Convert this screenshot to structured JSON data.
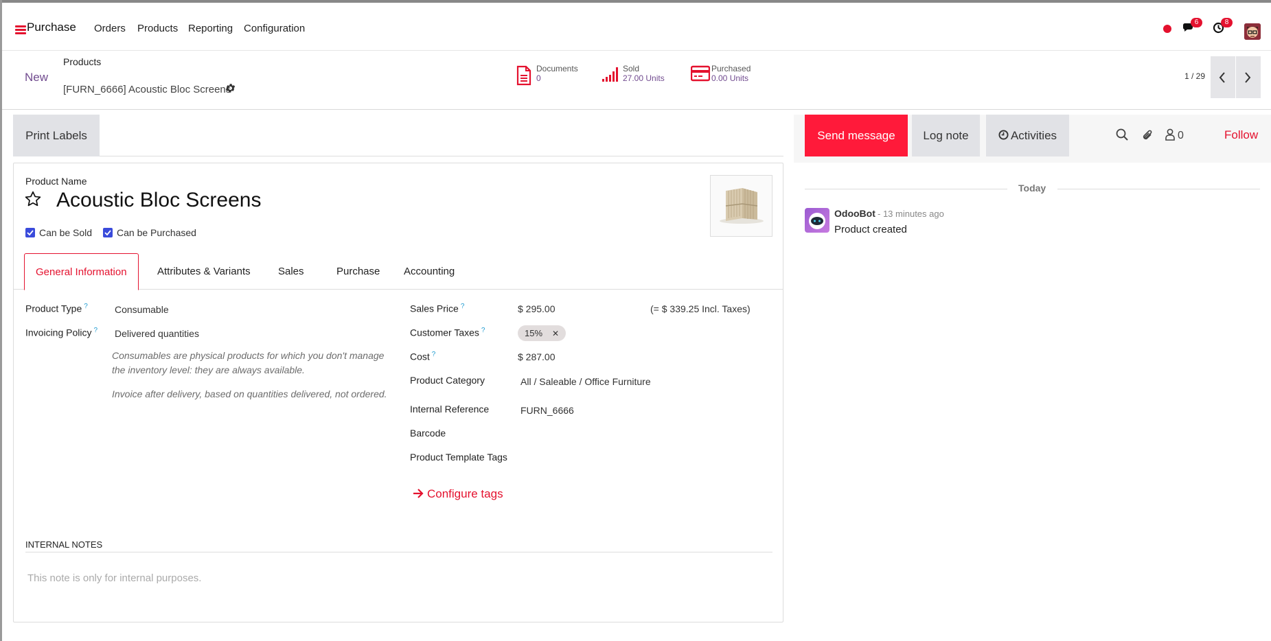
{
  "navbar": {
    "app_name": "Purchase",
    "menu": [
      "Orders",
      "Products",
      "Reporting",
      "Configuration"
    ],
    "messages_count": "6",
    "activities_count": "8"
  },
  "control_panel": {
    "new_label": "New",
    "breadcrumb_parent": "Products",
    "breadcrumb_current": "[FURN_6666] Acoustic Bloc Screens",
    "stats": {
      "documents": {
        "label": "Documents",
        "value": "0"
      },
      "sold": {
        "label": "Sold",
        "value": "27.00 Units"
      },
      "purchased": {
        "label": "Purchased",
        "value": "0.00 Units"
      }
    },
    "pager": "1 / 29"
  },
  "actions": {
    "print_labels": "Print Labels"
  },
  "form": {
    "product_name_label": "Product Name",
    "product_name": "Acoustic Bloc Screens",
    "can_be_sold": "Can be Sold",
    "can_be_purchased": "Can be Purchased",
    "tabs": [
      "General Information",
      "Attributes & Variants",
      "Sales",
      "Purchase",
      "Accounting"
    ],
    "left_fields": {
      "product_type_label": "Product Type",
      "product_type": "Consumable",
      "invoicing_policy_label": "Invoicing Policy",
      "invoicing_policy": "Delivered quantities",
      "help_consumable": "Consumables are physical products for which you don't manage the inventory level: they are always available.",
      "help_invoice": "Invoice after delivery, based on quantities delivered, not ordered."
    },
    "right_fields": {
      "sales_price_label": "Sales Price",
      "sales_price": "$ 295.00",
      "incl_taxes": "(= $ 339.25 Incl. Taxes)",
      "customer_taxes_label": "Customer Taxes",
      "tax_tag": "15%",
      "cost_label": "Cost",
      "cost": "$ 287.00",
      "product_category_label": "Product Category",
      "product_category": "All / Saleable / Office Furniture",
      "internal_reference_label": "Internal Reference",
      "internal_reference": "FURN_6666",
      "barcode_label": "Barcode",
      "template_tags_label": "Product Template Tags",
      "configure_tags": "Configure tags"
    },
    "internal_notes_label": "INTERNAL NOTES",
    "internal_notes_placeholder": "This note is only for internal purposes."
  },
  "chatter": {
    "send_message": "Send message",
    "log_note": "Log note",
    "activities": "Activities",
    "followers_count": "0",
    "follow": "Follow",
    "today": "Today",
    "message": {
      "author": "OdooBot",
      "time": "- 13 minutes ago",
      "body": "Product created"
    }
  },
  "colors": {
    "brand": "#e4112e",
    "accent": "#714b8f",
    "checkbox": "#3a4bdb"
  }
}
